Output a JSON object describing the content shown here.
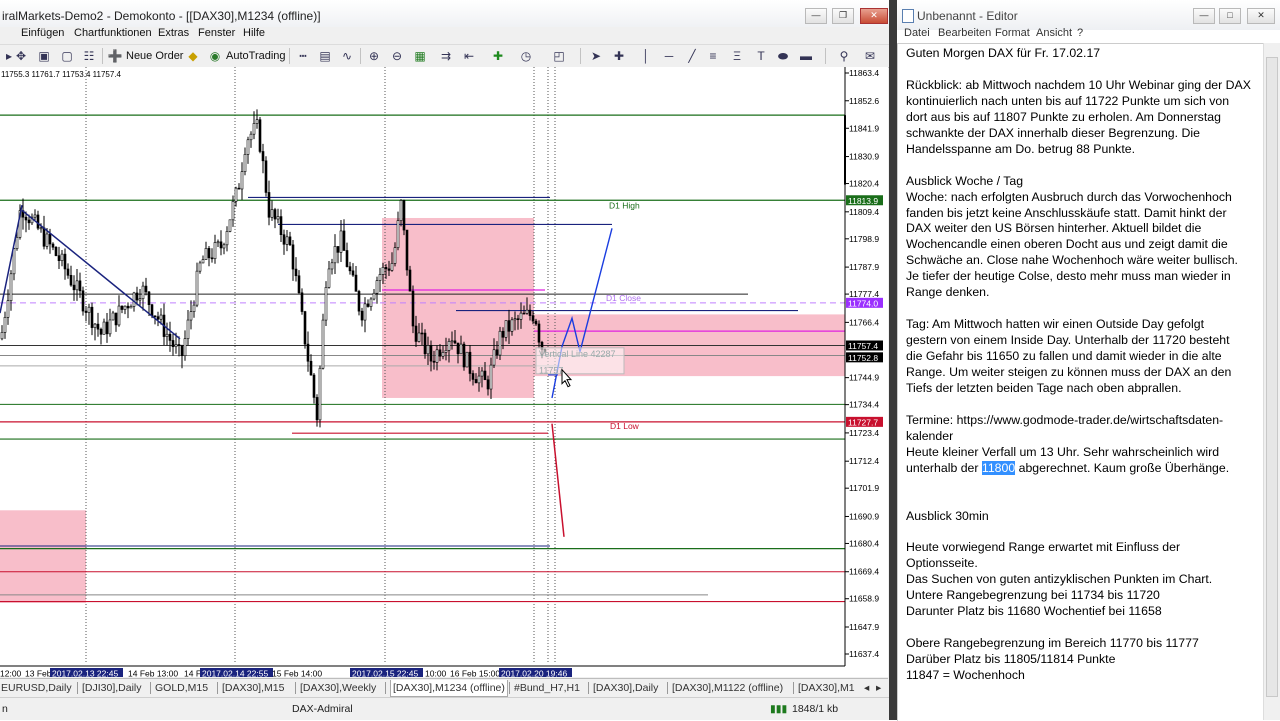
{
  "mt4": {
    "title": "iralMarkets-Demo2 - Demokonto - [[DAX30],M1234 (offline)]",
    "menu": [
      "Einfügen",
      "Chartfunktionen",
      "Extras",
      "Fenster",
      "Hilfe"
    ],
    "toolbar": {
      "neue_order": "Neue Order",
      "autotrading": "AutoTrading"
    },
    "ohlc": "11755.3 11761.7 11753.4 11757.4",
    "price_ticks": [
      "11863.4",
      "11852.6",
      "11841.9",
      "11830.9",
      "11820.4",
      "11809.4",
      "11798.9",
      "11787.9",
      "11777.4",
      "11766.4",
      "11744.9",
      "11734.4",
      "11723.4",
      "11712.4",
      "11701.9",
      "11690.9",
      "11680.4",
      "11669.4",
      "11658.9",
      "11647.9",
      "11637.4"
    ],
    "price_tags": [
      {
        "text": "11813.9",
        "color": "#1a6e1a"
      },
      {
        "text": "11774.0",
        "color": "#9b30ff"
      },
      {
        "text": "11757.4",
        "color": "#000000"
      },
      {
        "text": "11752.8",
        "color": "#000000"
      },
      {
        "text": "11727.7",
        "color": "#c8102e"
      }
    ],
    "chart_labels": {
      "d1_high": "D1 High",
      "d1_close": "D1 Close",
      "d1_low": "D1 Low",
      "tooltip_line1": "Vertical Line 42287",
      "tooltip_line2": "11757"
    },
    "time_axis": [
      {
        "text": "12:00",
        "hl": false
      },
      {
        "text": "13 Feb",
        "hl": false
      },
      {
        "text": "2017.02.13 22:45",
        "hl": true
      },
      {
        "text": "14 Feb 13:00",
        "hl": false
      },
      {
        "text": "14 F",
        "hl": false
      },
      {
        "text": "2017.02.14 22:55",
        "hl": true
      },
      {
        "text": "15 Feb 14:00",
        "hl": false
      },
      {
        "text": "2017.02.15 22:45",
        "hl": true
      },
      {
        "text": "10:00",
        "hl": false
      },
      {
        "text": "16 Feb 15:00",
        "hl": false
      },
      {
        "text": "2017.02.20 19:46",
        "hl": true
      }
    ],
    "tabs": [
      "EURUSD,Daily",
      "[DJI30],Daily",
      "GOLD,M15",
      "[DAX30],M15",
      "[DAX30],Weekly",
      "[DAX30],M1234 (offline)",
      "#Bund_H7,H1",
      "[DAX30],Daily",
      "[DAX30],M1122 (offline)",
      "[DAX30],M1"
    ],
    "active_tab": "[DAX30],M1234 (offline)",
    "status": {
      "left": "n",
      "profile": "DAX-Admiral",
      "traffic": "1848/1 kb"
    },
    "colors": {
      "bull": "#000000",
      "bear": "#000000",
      "zone": "#f5a8b8",
      "green": "#1a6e1a",
      "red": "#c8102e",
      "navy": "#1a237e",
      "magenta": "#e020e0"
    }
  },
  "notepad": {
    "title": "Unbenannt - Editor",
    "menu": [
      "Datei",
      "Bearbeiten",
      "Format",
      "Ansicht",
      "?"
    ],
    "lines": [
      "Guten Morgen DAX für Fr. 17.02.17",
      "",
      "Rückblick: ab Mittwoch nachdem 10 Uhr Webinar ging der DAX",
      "kontinuierlich nach unten bis auf 11722 Punkte um sich von",
      "dort aus bis auf 11807 Punkte zu erholen. Am Donnerstag",
      "schwankte der DAX innerhalb dieser Begrenzung. Die",
      "Handelsspanne am Do. betrug 88 Punkte.",
      "",
      "Ausblick Woche / Tag",
      "Woche: nach erfolgten Ausbruch durch das Vorwochenhoch",
      "fanden bis jetzt keine Anschlusskäufe statt. Damit hinkt der",
      "DAX weiter den US Börsen hinterher. Aktuell bildet die",
      "Wochencandle einen oberen Docht aus und zeigt damit die",
      "Schwäche an.  Close nahe Wochenhoch wäre weiter bullisch.",
      "Je tiefer der heutige Colse, desto mehr muss man wieder in",
      "Range denken.",
      "",
      "Tag: Am Mittwoch hatten wir einen Outside Day gefolgt",
      "gestern von einem Inside Day. Unterhalb der 11720 besteht",
      "die Gefahr bis 11650 zu fallen und damit wieder in die alte",
      "Range.  Um weiter steigen zu können muss der DAX an den",
      "Tiefs der letzten beiden Tage nach oben abprallen.",
      "",
      "Termine: https://www.godmode-trader.de/wirtschaftsdaten-",
      "kalender",
      "Heute kleiner Verfall um 13 Uhr. Sehr wahrscheinlich wird",
      "",
      "",
      "",
      "Ausblick 30min",
      "",
      "Heute vorwiegend Range erwartet mit Einfluss der",
      "Optionsseite.",
      "Das Suchen von guten antizyklischen Punkten im Chart.",
      "Untere Rangebegrenzung bei 11734 bis 11720",
      "Darunter Platz bis 11680 Wochentief bei 11658",
      "",
      "Obere Rangebegrenzung im Bereich 11770 bis 11777",
      "Darüber Platz bis 11805/11814 Punkte",
      "11847 = Wochenhoch"
    ],
    "selection_line": {
      "before": "unterhalb der ",
      "selected": "11800",
      "after": " abgerechnet.  Kaum große Überhänge."
    }
  }
}
